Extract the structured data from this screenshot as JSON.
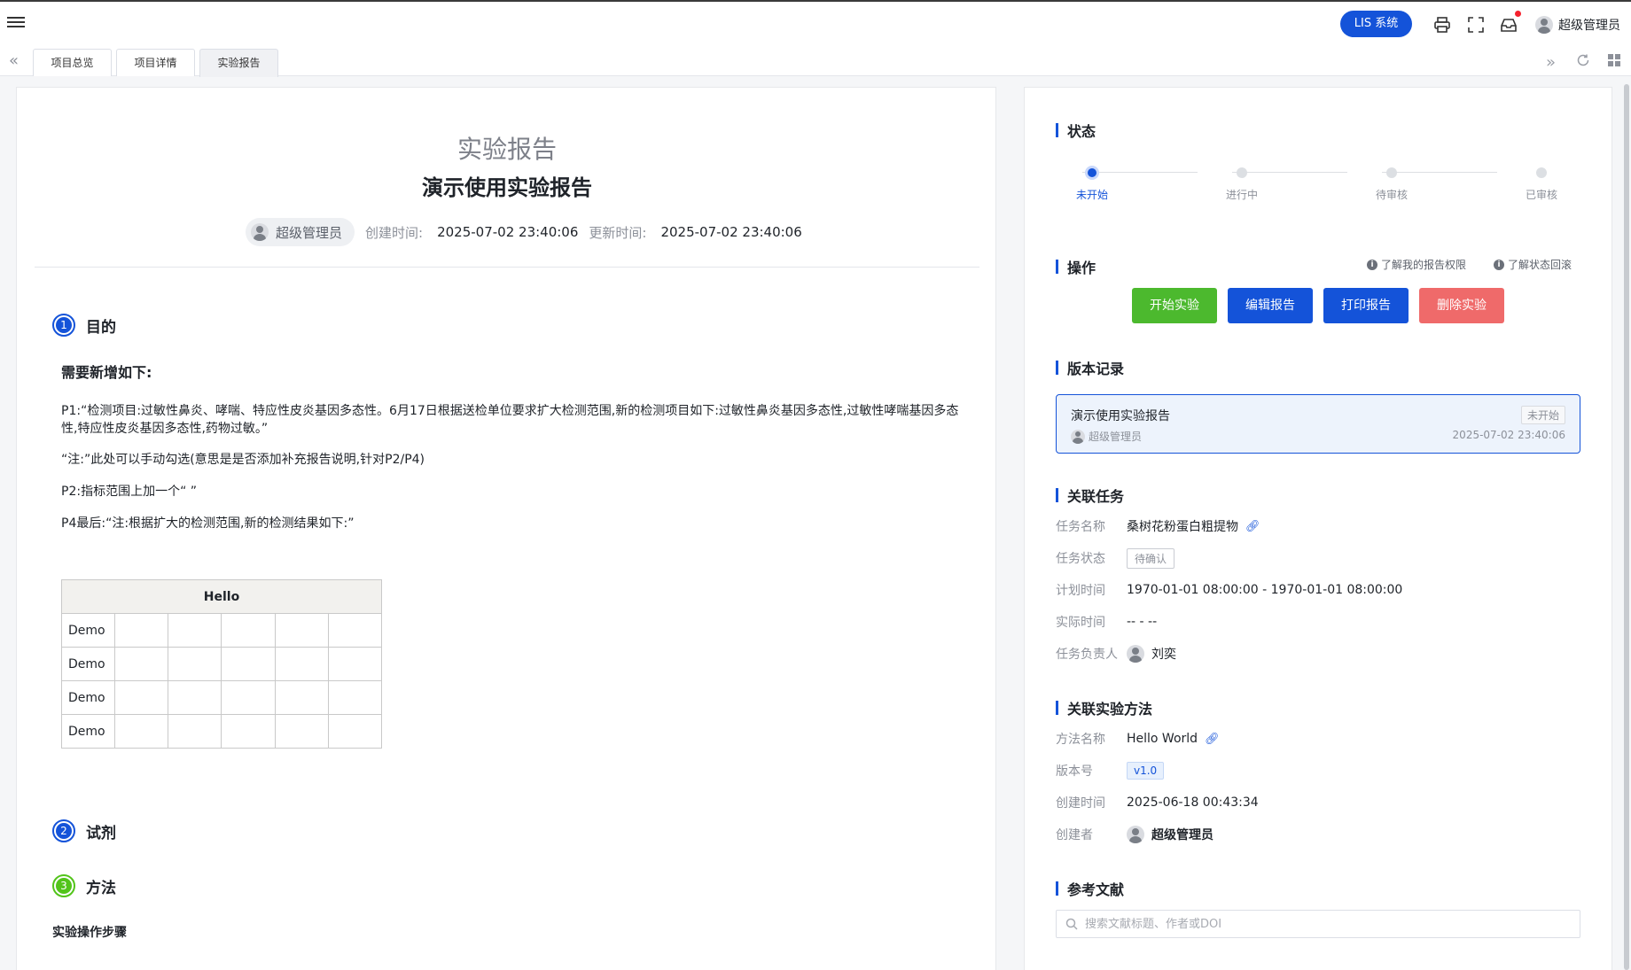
{
  "topbar": {
    "system_button": "LIS 系统",
    "user_name": "超级管理员",
    "icons": [
      "menu-icon",
      "print-icon",
      "fullscreen-icon",
      "inbox-icon"
    ]
  },
  "tabs": [
    {
      "label": "项目总览"
    },
    {
      "label": "项目详情"
    },
    {
      "label": "实验报告"
    }
  ],
  "report": {
    "label": "实验报告",
    "title": "演示使用实验报告",
    "author": "超级管理员",
    "created_label": "创建时间:",
    "created_value": "2025-07-02 23:40:06",
    "updated_label": "更新时间:",
    "updated_value": "2025-07-02 23:40:06",
    "sections": [
      {
        "num": "1",
        "title": "目的"
      },
      {
        "num": "2",
        "title": "试剂"
      },
      {
        "num": "3",
        "title": "方法"
      }
    ],
    "purpose": {
      "heading": "需要新增如下:",
      "p1": "P1:“检测项目:过敏性鼻炎、哮喘、特应性皮炎基因多态性。6月17日根据送检单位要求扩大检测范围,新的检测项目如下:过敏性鼻炎基因多态性,过敏性哮喘基因多态性,特应性皮炎基因多态性,药物过敏。”",
      "note": "“注:”此处可以手动勾选(意思是是否添加补充报告说明,针对P2/P4)",
      "p2": "P2:指标范围上加一个“ ”",
      "p4": "P4最后:“注:根据扩大的检测范围,新的检测结果如下:”"
    },
    "table": {
      "header": "Hello",
      "rows": [
        "Demo",
        "Demo",
        "Demo",
        "Demo"
      ]
    },
    "method_steps_label": "实验操作步骤"
  },
  "side": {
    "status": {
      "title": "状态",
      "steps": [
        "未开始",
        "进行中",
        "待审核",
        "已审核"
      ],
      "current": 0
    },
    "operations": {
      "title": "操作",
      "link_permissions": "了解我的报告权限",
      "link_rollback": "了解状态回滚",
      "buttons": [
        {
          "label": "开始实验",
          "color": "#4cb92e"
        },
        {
          "label": "编辑报告",
          "color": "#1453d9"
        },
        {
          "label": "打印报告",
          "color": "#1453d9"
        },
        {
          "label": "删除实验",
          "color": "#ef6a6a"
        }
      ]
    },
    "versions": {
      "title": "版本记录",
      "item": {
        "title": "演示使用实验报告",
        "status": "未开始",
        "author": "超级管理员",
        "time": "2025-07-02 23:40:06"
      }
    },
    "task": {
      "title": "关联任务",
      "name_label": "任务名称",
      "name_value": "桑树花粉蛋白粗提物",
      "status_label": "任务状态",
      "status_value": "待确认",
      "plan_label": "计划时间",
      "plan_value": "1970-01-01 08:00:00 - 1970-01-01 08:00:00",
      "actual_label": "实际时间",
      "actual_value": "-- - --",
      "owner_label": "任务负责人",
      "owner_value": "刘奕"
    },
    "method": {
      "title": "关联实验方法",
      "name_label": "方法名称",
      "name_value": "Hello World",
      "version_label": "版本号",
      "version_value": "v1.0",
      "created_label": "创建时间",
      "created_value": "2025-06-18 00:43:34",
      "creator_label": "创建者",
      "creator_value": "超级管理员"
    },
    "references": {
      "title": "参考文献",
      "placeholder": "搜索文献标题、作者或DOI"
    }
  }
}
